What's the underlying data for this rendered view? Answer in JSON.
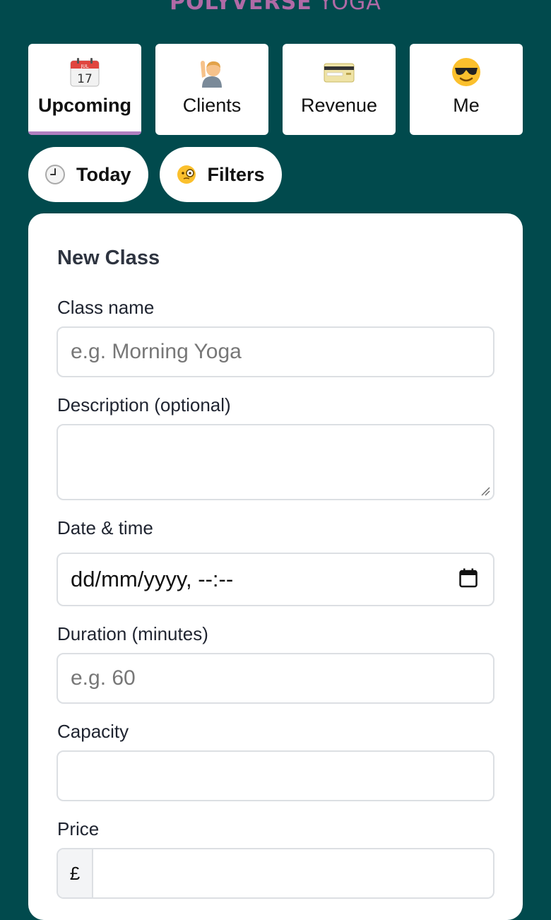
{
  "brand": {
    "part1": "POLYVERSE",
    "part2": "YOGA"
  },
  "tabs": [
    {
      "label": "Upcoming",
      "icon": "calendar-icon",
      "active": true
    },
    {
      "label": "Clients",
      "icon": "person-raising-hand-icon"
    },
    {
      "label": "Revenue",
      "icon": "credit-card-icon"
    },
    {
      "label": "Me",
      "icon": "sunglasses-face-icon"
    }
  ],
  "pills": [
    {
      "label": "Today",
      "icon": "clock-icon"
    },
    {
      "label": "Filters",
      "icon": "monocle-face-icon"
    }
  ],
  "form": {
    "title": "New Class",
    "class_name": {
      "label": "Class name",
      "placeholder": "e.g. Morning Yoga"
    },
    "description": {
      "label": "Description (optional)"
    },
    "datetime": {
      "label": "Date & time",
      "value": "dd/mm/yyyy, --:--"
    },
    "duration": {
      "label": "Duration (minutes)",
      "placeholder": "e.g. 60"
    },
    "capacity": {
      "label": "Capacity"
    },
    "price": {
      "label": "Price",
      "currency": "£"
    }
  },
  "colors": {
    "background": "#014a4d",
    "brand": "#b06aa6",
    "active_underline": "#b07fc0"
  }
}
